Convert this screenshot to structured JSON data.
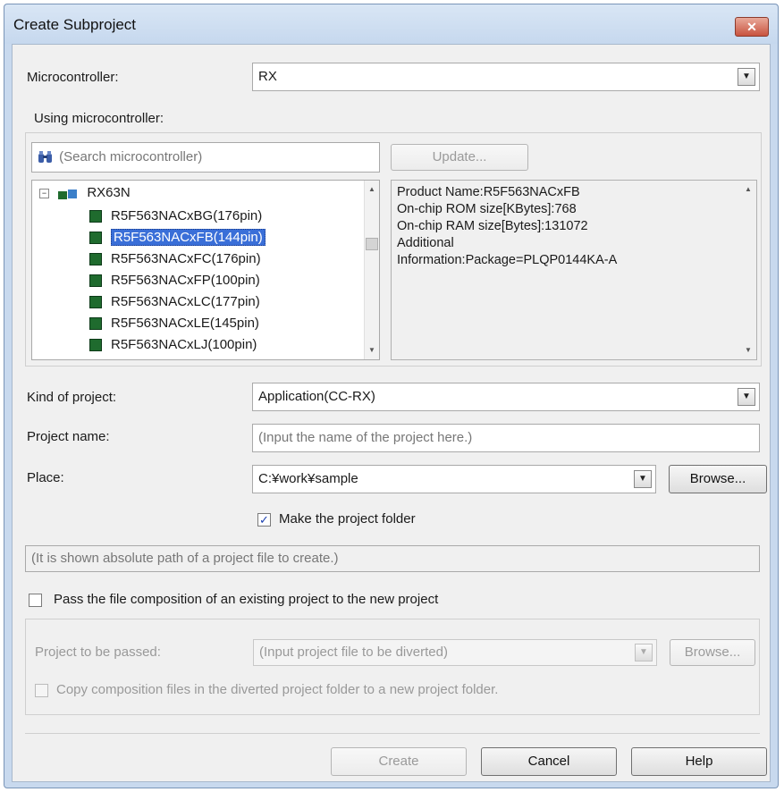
{
  "window": {
    "title": "Create Subproject",
    "close_label": "✕"
  },
  "microcontroller": {
    "label": "Microcontroller:",
    "value": "RX"
  },
  "using_micro": {
    "label": "Using microcontroller:"
  },
  "search": {
    "placeholder": "(Search microcontroller)",
    "update_label": "Update..."
  },
  "tree": {
    "root": "RX63N",
    "items": [
      "R5F563NACxBG(176pin)",
      "R5F563NACxFB(144pin)",
      "R5F563NACxFC(176pin)",
      "R5F563NACxFP(100pin)",
      "R5F563NACxLC(177pin)",
      "R5F563NACxLE(145pin)",
      "R5F563NACxLJ(100pin)"
    ],
    "selected_index": 1
  },
  "info_lines": [
    "Product Name:R5F563NACxFB",
    "On-chip ROM size[KBytes]:768",
    "On-chip RAM size[Bytes]:131072",
    "Additional",
    "Information:Package=PLQP0144KA-A"
  ],
  "kind": {
    "label": "Kind of project:",
    "value": "Application(CC-RX)"
  },
  "project_name": {
    "label": "Project name:",
    "placeholder": "(Input the name of the project here.)"
  },
  "place": {
    "label": "Place:",
    "value": "C:¥work¥sample",
    "browse_label": "Browse..."
  },
  "make_folder": {
    "label": "Make the project folder",
    "checked": true
  },
  "abs_path": {
    "text": "(It is shown absolute path of a project file to create.)"
  },
  "pass_files": {
    "label": "Pass the file composition of an existing project to the new project",
    "checked": false
  },
  "to_be_passed": {
    "label": "Project to be passed:",
    "placeholder": "(Input project file to be diverted)",
    "browse_label": "Browse..."
  },
  "copy_files": {
    "label": "Copy composition files in the diverted project folder to a new project folder.",
    "checked": false
  },
  "buttons": {
    "create": "Create",
    "cancel": "Cancel",
    "help": "Help"
  },
  "icons": {
    "search": "search-binoculars-icon",
    "combo": "dropdown-arrow-icon",
    "chip": "chip-icon"
  }
}
